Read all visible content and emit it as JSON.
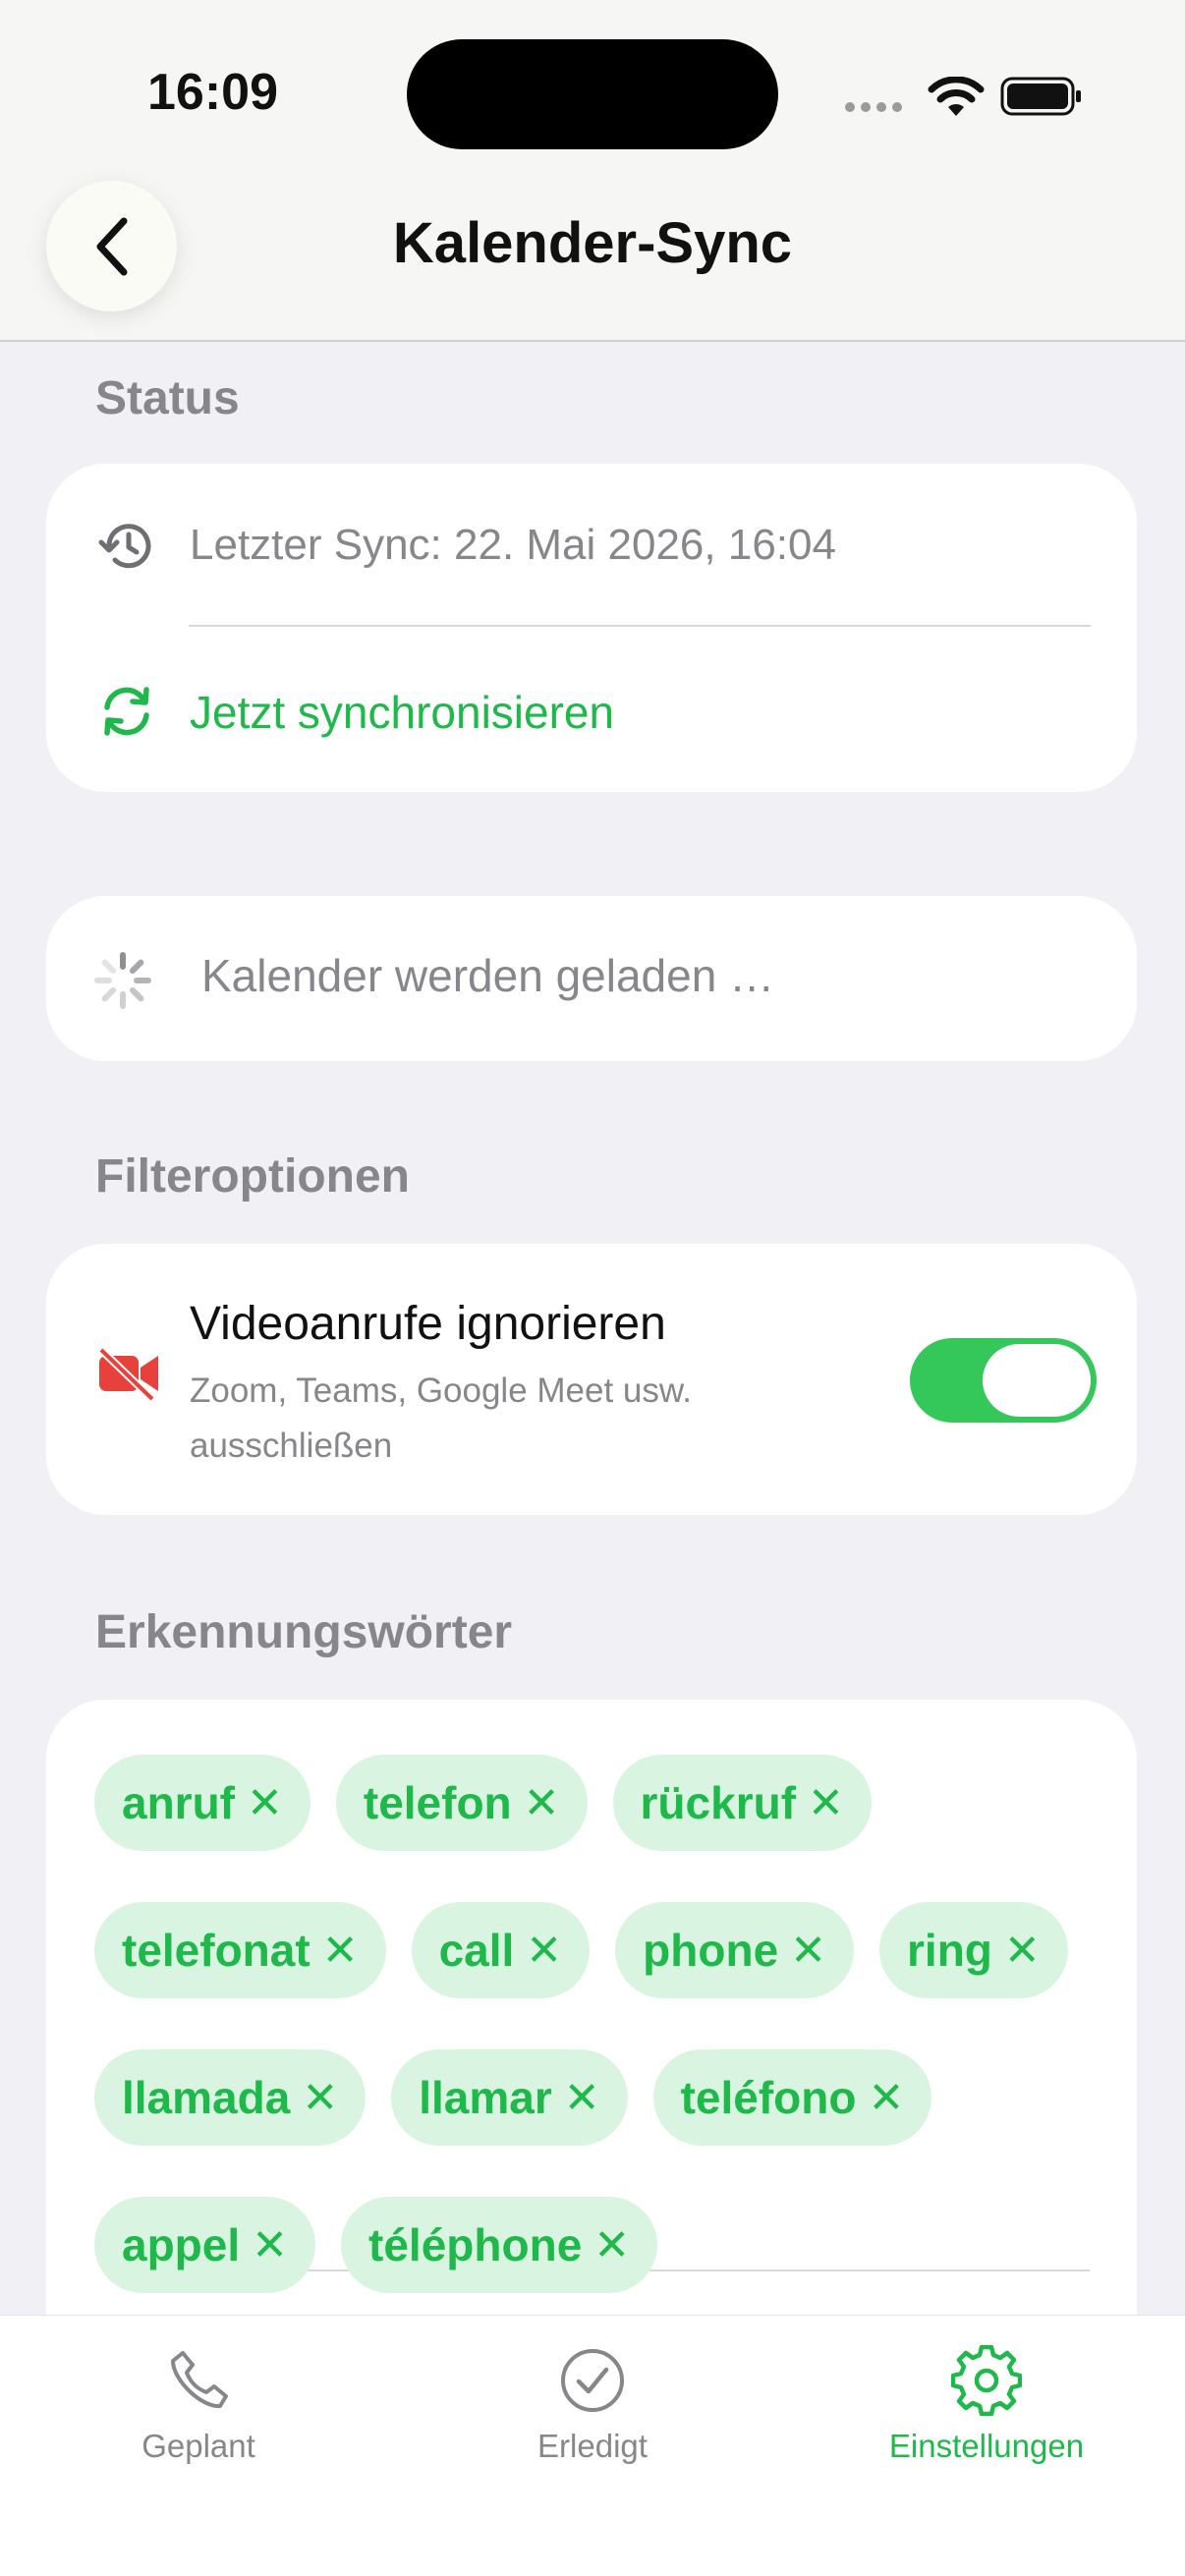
{
  "status_bar": {
    "time": "16:09"
  },
  "header": {
    "title": "Kalender-Sync",
    "back_icon": "chevron-left-icon"
  },
  "status_section": {
    "label": "Status",
    "last_sync": "Letzter Sync: 22. Mai 2026, 16:04",
    "sync_now": "Jetzt synchronisieren"
  },
  "calendars": {
    "loading_text": "Kalender werden geladen …"
  },
  "filter_section": {
    "label": "Filteroptionen",
    "video_title": "Videoanrufe ignorieren",
    "video_subtitle_line1": "Zoom, Teams, Google Meet usw.",
    "video_subtitle_line2": "ausschließen",
    "video_toggle_on": true
  },
  "keywords_section": {
    "label": "Erkennungswörter",
    "chips": [
      "anruf",
      "telefon",
      "rückruf",
      "telefonat",
      "call",
      "phone",
      "ring",
      "llamada",
      "llamar",
      "teléfono",
      "appel",
      "téléphone"
    ]
  },
  "tabbar": {
    "tabs": [
      {
        "label": "Geplant",
        "icon": "phone-icon"
      },
      {
        "label": "Erledigt",
        "icon": "checkmark-circle-icon"
      },
      {
        "label": "Einstellungen",
        "icon": "gear-icon"
      }
    ]
  },
  "colors": {
    "accent": "#1fb84a",
    "toggle_on": "#34c759",
    "video_icon": "#e8413c"
  }
}
